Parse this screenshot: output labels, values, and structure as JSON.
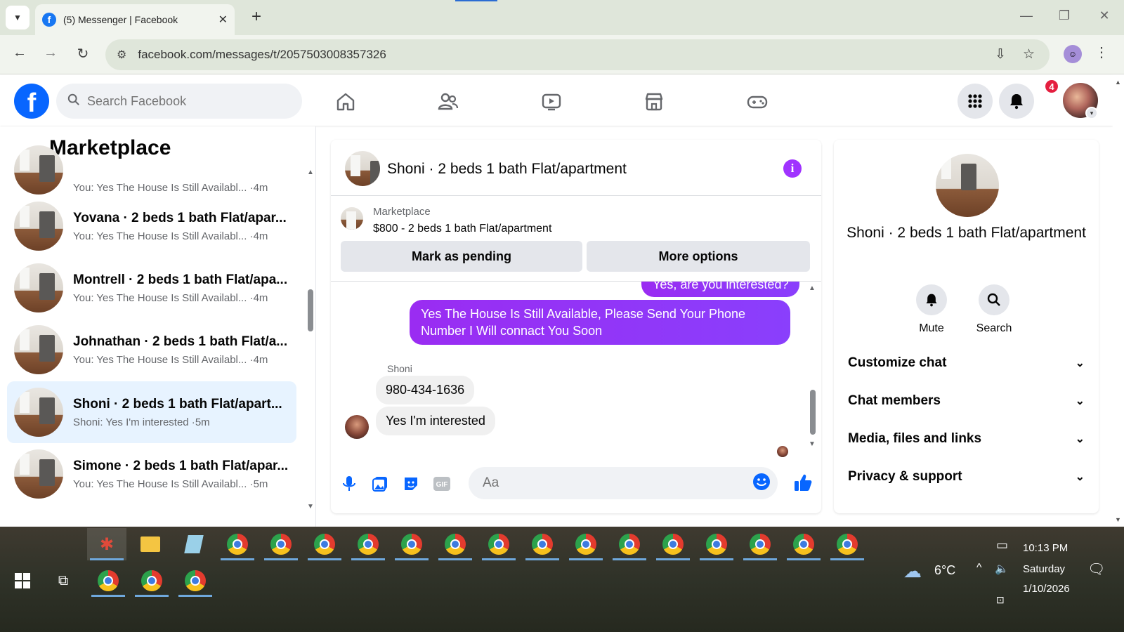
{
  "browser": {
    "tab_title": "(5) Messenger | Facebook",
    "url": "facebook.com/messages/t/2057503008357326"
  },
  "header": {
    "search_placeholder": "Search Facebook",
    "notification_count": "4"
  },
  "left": {
    "title": "Marketplace",
    "conversations": [
      {
        "name": "",
        "preview": "You: Yes The House Is Still Availabl...",
        "time": "4m"
      },
      {
        "name": "Yovana · 2 beds 1 bath Flat/apar...",
        "preview": "You: Yes The House Is Still Availabl...",
        "time": "4m"
      },
      {
        "name": "Montrell · 2 beds 1 bath Flat/apa...",
        "preview": "You: Yes The House Is Still Availabl...",
        "time": "4m"
      },
      {
        "name": "Johnathan · 2 beds 1 bath Flat/a...",
        "preview": "You: Yes The House Is Still Availabl...",
        "time": "4m"
      },
      {
        "name": "Shoni · 2 beds 1 bath Flat/apart...",
        "preview": "Shoni: Yes I'm interested",
        "time": "5m"
      },
      {
        "name": "Simone · 2 beds 1 bath Flat/apar...",
        "preview": "You: Yes The House Is Still Availabl...",
        "time": "5m"
      }
    ]
  },
  "chat": {
    "title": "Shoni · 2 beds 1 bath Flat/apartment",
    "listing_label": "Marketplace",
    "listing_price": "$800 - 2 beds 1 bath Flat/apartment",
    "mark_pending": "Mark as pending",
    "more_options": "More options",
    "messages": {
      "out1": "Yes, are you interested?",
      "out2": "Yes The House Is Still Available, Please Send Your Phone Number I Will connact You Soon",
      "sender": "Shoni",
      "in1": "980-434-1636",
      "in2": "Yes I'm interested"
    },
    "input_placeholder": "Aa"
  },
  "right": {
    "title": "Shoni · 2 beds 1 bath Flat/apartment",
    "mute": "Mute",
    "search": "Search",
    "rows": [
      "Customize chat",
      "Chat members",
      "Media, files and links",
      "Privacy & support"
    ]
  },
  "taskbar": {
    "weather": "6°C",
    "time": "10:13 PM",
    "day": "Saturday",
    "date": "1/10/2026"
  }
}
